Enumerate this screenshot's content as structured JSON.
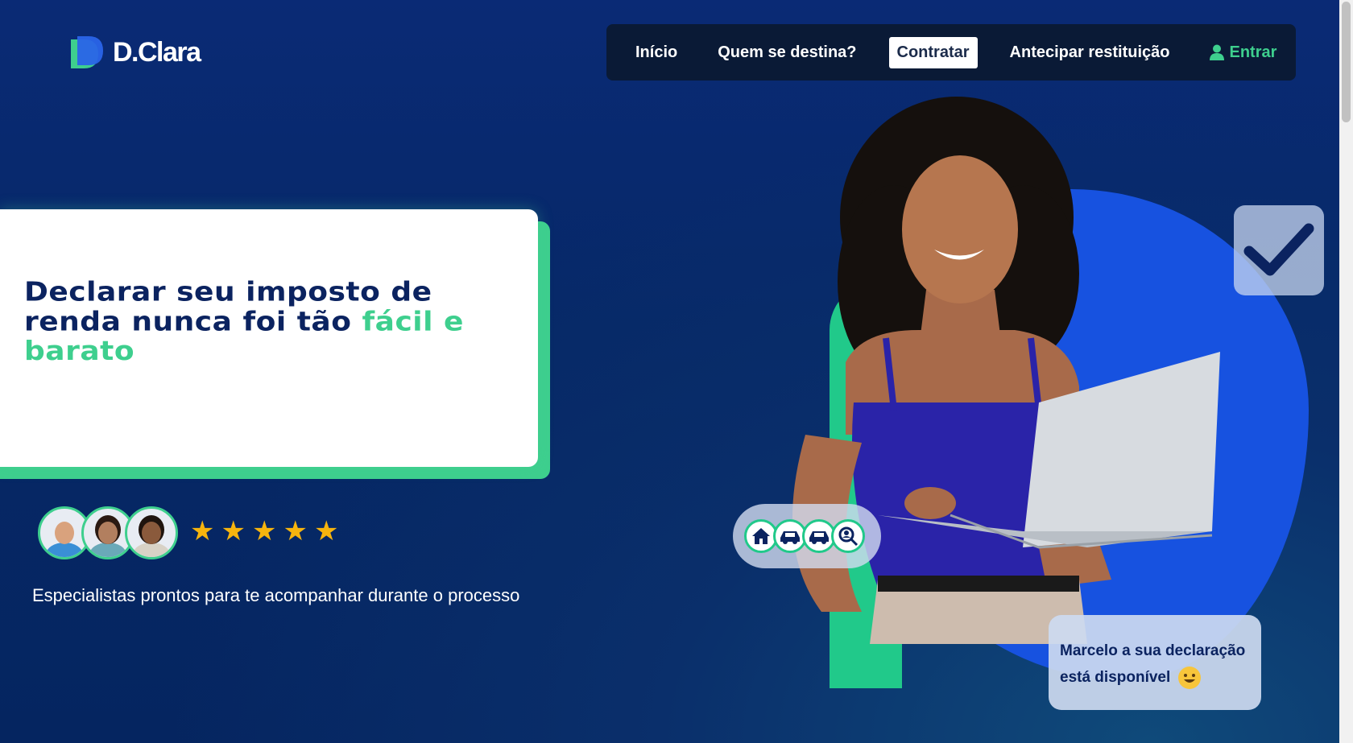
{
  "brand": {
    "name": "D.Clara",
    "accent": "#3ecf8e",
    "dark": "#0b2360"
  },
  "nav": {
    "items": [
      {
        "label": "Início"
      },
      {
        "label": "Quem se destina?"
      },
      {
        "label": "Contratar"
      },
      {
        "label": "Antecipar restituição"
      }
    ],
    "login_label": "Entrar"
  },
  "hero": {
    "headline_main": "Declarar seu imposto de renda nunca foi tão ",
    "headline_accent": "fácil e barato",
    "rating_stars": 5,
    "subtext": "Especialistas prontos para te acompanhar durante o processo"
  },
  "notification": {
    "line1": "Marcelo a sua declaração",
    "line2": "está disponível"
  },
  "icons": [
    "house-icon",
    "car-icon",
    "car-icon",
    "search-person-icon",
    "check-icon",
    "user-icon",
    "smile-emoji"
  ]
}
